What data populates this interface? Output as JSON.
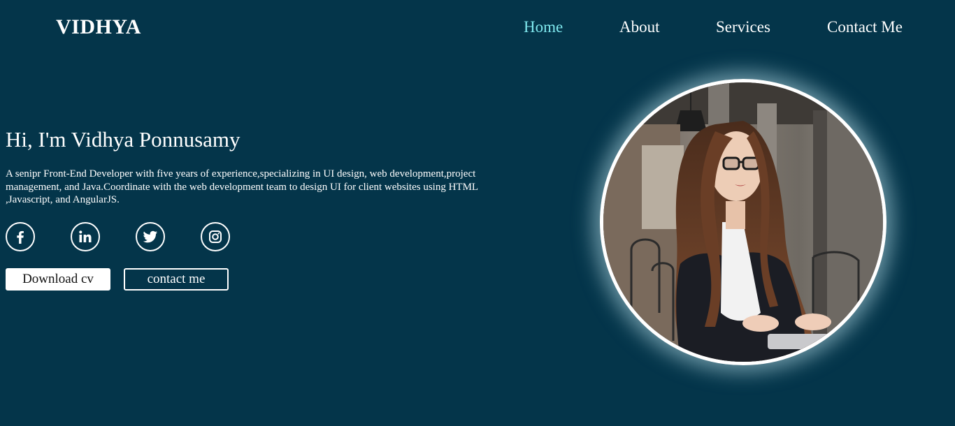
{
  "header": {
    "logo": "VIDHYA",
    "nav": [
      {
        "label": "Home",
        "active": true
      },
      {
        "label": "About",
        "active": false
      },
      {
        "label": "Services",
        "active": false
      },
      {
        "label": "Contact Me",
        "active": false
      }
    ]
  },
  "hero": {
    "title": "Hi, I'm Vidhya Ponnusamy",
    "description": "A senipr Front-End Developer with five years of experience,specializing in UI design, web development,project management, and Java.Coordinate with the web development team to design UI for client websites using HTML ,Javascript, and AngularJS.",
    "socials": [
      {
        "icon": "facebook-icon"
      },
      {
        "icon": "linkedin-icon"
      },
      {
        "icon": "twitter-icon"
      },
      {
        "icon": "instagram-icon"
      }
    ],
    "buttons": {
      "download": "Download cv",
      "contact": "contact me"
    }
  },
  "colors": {
    "background": "#04354a",
    "accent": "#7fe8ee",
    "text": "#ffffff"
  }
}
